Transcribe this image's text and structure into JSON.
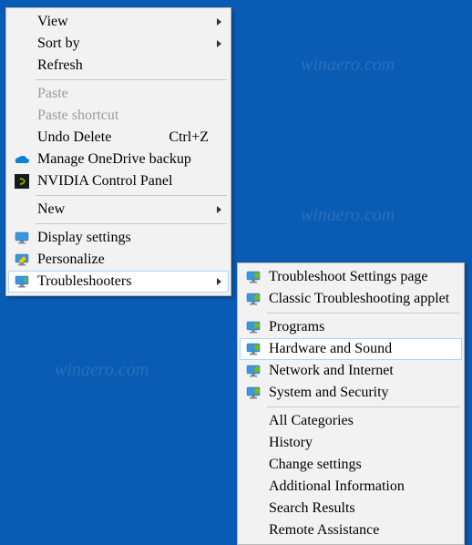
{
  "background": "#0a5bb4",
  "watermark_text": "winaero.com",
  "main_menu": {
    "items": [
      {
        "label": "View",
        "has_submenu": true
      },
      {
        "label": "Sort by",
        "has_submenu": true
      },
      {
        "label": "Refresh"
      },
      {
        "sep": true
      },
      {
        "label": "Paste",
        "disabled": true
      },
      {
        "label": "Paste shortcut",
        "disabled": true
      },
      {
        "label": "Undo Delete",
        "shortcut": "Ctrl+Z"
      },
      {
        "label": "Manage OneDrive backup",
        "icon": "onedrive-icon"
      },
      {
        "label": "NVIDIA Control Panel",
        "icon": "nvidia-icon"
      },
      {
        "sep": true
      },
      {
        "label": "New",
        "has_submenu": true
      },
      {
        "sep": true
      },
      {
        "label": "Display settings",
        "icon": "display-icon"
      },
      {
        "label": "Personalize",
        "icon": "personalize-icon"
      },
      {
        "label": "Troubleshooters",
        "icon": "troubleshoot-icon",
        "has_submenu": true,
        "hover": true
      }
    ]
  },
  "sub_menu": {
    "items": [
      {
        "label": "Troubleshoot Settings page",
        "icon": "troubleshoot-icon"
      },
      {
        "label": "Classic Troubleshooting applet",
        "icon": "troubleshoot-icon"
      },
      {
        "sep": true
      },
      {
        "label": "Programs",
        "icon": "troubleshoot-icon"
      },
      {
        "label": "Hardware and Sound",
        "icon": "troubleshoot-icon",
        "hover": true
      },
      {
        "label": "Network and Internet",
        "icon": "troubleshoot-icon"
      },
      {
        "label": "System and Security",
        "icon": "troubleshoot-icon"
      },
      {
        "sep": true
      },
      {
        "label": "All Categories",
        "indent": true
      },
      {
        "label": "History",
        "indent": true
      },
      {
        "label": "Change settings",
        "indent": true
      },
      {
        "label": "Additional Information",
        "indent": true
      },
      {
        "label": "Search Results",
        "indent": true
      },
      {
        "label": "Remote Assistance",
        "indent": true
      }
    ]
  }
}
